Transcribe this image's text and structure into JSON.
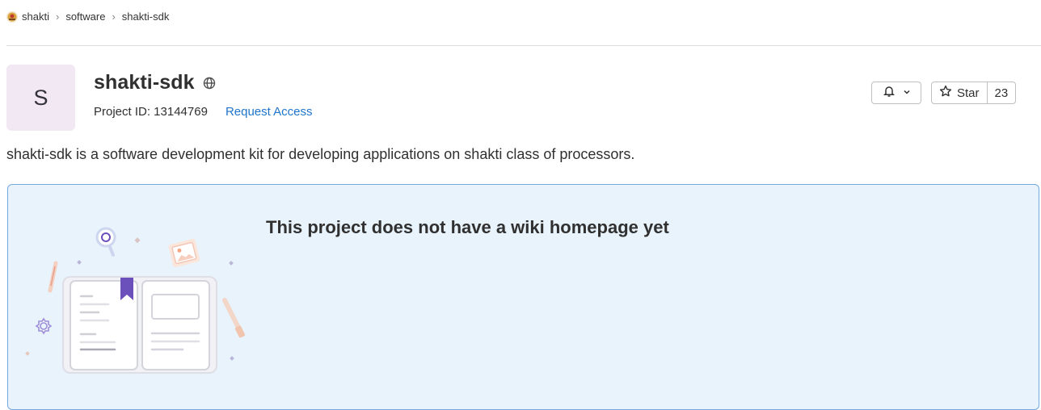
{
  "breadcrumb": {
    "items": [
      "shakti",
      "software",
      "shakti-sdk"
    ],
    "separator": "›"
  },
  "project": {
    "avatar_letter": "S",
    "name": "shakti-sdk",
    "id_label": "Project ID: 13144769",
    "request_access": "Request Access",
    "description": "shakti-sdk is a software development kit for developing applications on shakti class of processors.",
    "visibility_icon": "globe-icon"
  },
  "actions": {
    "notification_icon": "bell-icon",
    "star_label": "Star",
    "star_count": "23"
  },
  "wiki_empty": {
    "title": "This project does not have a wiki homepage yet"
  },
  "colors": {
    "link": "#1f75cb",
    "panel_bg": "#e9f3fc",
    "panel_border": "#74a9e0",
    "avatar_bg": "#f2e8f4",
    "bookmark": "#6b4fbb"
  }
}
